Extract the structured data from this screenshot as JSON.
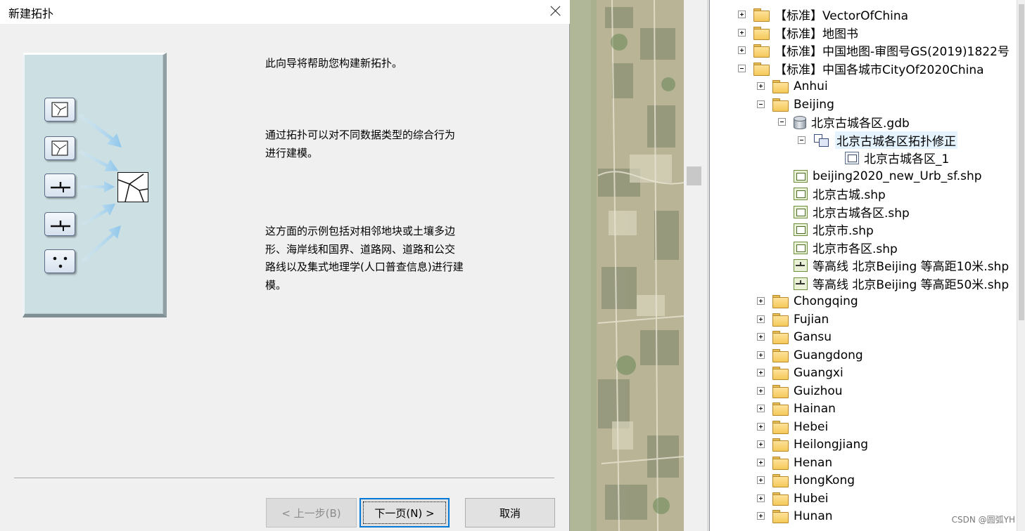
{
  "dialog": {
    "title": "新建拓扑",
    "paragraphs": [
      "此向导将帮助您构建新拓扑。",
      "通过拓扑可以对不同数据类型的综合行为\n进行建模。",
      "这方面的示例包括对相邻地块或土壤多边\n形、海岸线和国界、道路网、道路和公交\n路线以及集式地理学(人口普查信息)进行建\n模。"
    ],
    "buttons": {
      "back": "< 上一步(B)",
      "next": "下一页(N) >",
      "cancel": "取消"
    }
  },
  "tree": {
    "items": [
      {
        "level": 0,
        "expander": "plus",
        "icon": "folder-icon",
        "label": "【标准】VectorOfChina"
      },
      {
        "level": 0,
        "expander": "plus",
        "icon": "folder-icon",
        "label": "【标准】地图书"
      },
      {
        "level": 0,
        "expander": "plus",
        "icon": "folder-icon",
        "label": "【标准】中国地图-审图号GS(2019)1822号"
      },
      {
        "level": 0,
        "expander": "minus",
        "icon": "folder-icon",
        "label": "【标准】中国各城市CityOf2020China"
      },
      {
        "level": 1,
        "expander": "plus",
        "icon": "folder-icon",
        "label": "Anhui"
      },
      {
        "level": 1,
        "expander": "minus",
        "icon": "folder-icon",
        "label": "Beijing"
      },
      {
        "level": 2,
        "expander": "minus",
        "icon": "geodatabase-icon",
        "label": "北京古城各区.gdb"
      },
      {
        "level": 3,
        "expander": "minus",
        "icon": "topology-icon",
        "label": "北京古城各区拓扑修正",
        "selected": true
      },
      {
        "level": 4,
        "expander": "none",
        "icon": "feature-class-icon",
        "label": "北京古城各区_1"
      },
      {
        "level": 2,
        "expander": "none",
        "icon": "polygon-shapefile-icon",
        "label": "beijing2020_new_Urb_sf.shp"
      },
      {
        "level": 2,
        "expander": "none",
        "icon": "polygon-shapefile-icon",
        "label": "北京古城.shp"
      },
      {
        "level": 2,
        "expander": "none",
        "icon": "polygon-shapefile-icon",
        "label": "北京古城各区.shp"
      },
      {
        "level": 2,
        "expander": "none",
        "icon": "polygon-shapefile-icon",
        "label": "北京市.shp"
      },
      {
        "level": 2,
        "expander": "none",
        "icon": "polygon-shapefile-icon",
        "label": "北京市各区.shp"
      },
      {
        "level": 2,
        "expander": "none",
        "icon": "line-shapefile-icon",
        "label": "等高线 北京Beijing 等高距10米.shp"
      },
      {
        "level": 2,
        "expander": "none",
        "icon": "line-shapefile-icon",
        "label": "等高线 北京Beijing 等高距50米.shp"
      },
      {
        "level": 1,
        "expander": "plus",
        "icon": "folder-icon",
        "label": "Chongqing"
      },
      {
        "level": 1,
        "expander": "plus",
        "icon": "folder-icon",
        "label": "Fujian"
      },
      {
        "level": 1,
        "expander": "plus",
        "icon": "folder-icon",
        "label": "Gansu"
      },
      {
        "level": 1,
        "expander": "plus",
        "icon": "folder-icon",
        "label": "Guangdong"
      },
      {
        "level": 1,
        "expander": "plus",
        "icon": "folder-icon",
        "label": "Guangxi"
      },
      {
        "level": 1,
        "expander": "plus",
        "icon": "folder-icon",
        "label": "Guizhou"
      },
      {
        "level": 1,
        "expander": "plus",
        "icon": "folder-icon",
        "label": "Hainan"
      },
      {
        "level": 1,
        "expander": "plus",
        "icon": "folder-icon",
        "label": "Hebei"
      },
      {
        "level": 1,
        "expander": "plus",
        "icon": "folder-icon",
        "label": "Heilongjiang"
      },
      {
        "level": 1,
        "expander": "plus",
        "icon": "folder-icon",
        "label": "Henan"
      },
      {
        "level": 1,
        "expander": "plus",
        "icon": "folder-icon",
        "label": "HongKong"
      },
      {
        "level": 1,
        "expander": "plus",
        "icon": "folder-icon",
        "label": "Hubei"
      },
      {
        "level": 1,
        "expander": "plus",
        "icon": "folder-icon",
        "label": "Hunan"
      }
    ]
  },
  "watermark": "CSDN @圆弧YH",
  "colors": {
    "dialog_bg": "#f0f0f0",
    "illustration_bg": "#ccdfe3",
    "focus_border": "#0078d7",
    "folder": "#f4c95a"
  }
}
